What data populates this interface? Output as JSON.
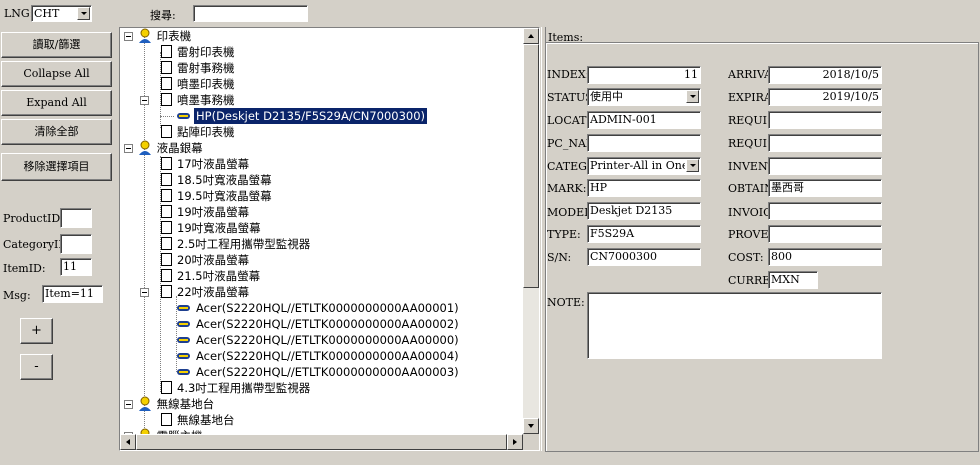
{
  "top": {
    "lng_label": "LNG:",
    "lng_value": "CHT",
    "search_label": "搜尋:",
    "search_value": ""
  },
  "left_buttons": {
    "read_filter": "讀取/篩選",
    "collapse_all": "Collapse All",
    "expand_all": "Expand All",
    "clear_all": "清除全部",
    "remove_selected": "移除選擇項目"
  },
  "left_fields": {
    "product_id_label": "ProductID:",
    "product_id": "",
    "category_id_label": "CategoryID:",
    "category_id": "",
    "item_id_label": "ItemID:",
    "item_id": "11",
    "msg_label": "Msg:",
    "msg": "Item=11",
    "plus": "+",
    "minus": "-"
  },
  "tree": {
    "cat1": "印表機",
    "cat1_items": [
      "雷射印表機",
      "雷射事務機",
      "噴墨印表機",
      "噴墨事務機"
    ],
    "cat1_selected_leaf": "HP(Deskjet D2135/F5S29A/CN7000300)",
    "cat1_last": "點陣印表機",
    "cat2": "液晶銀幕",
    "cat2_items": [
      "17吋液晶螢幕",
      "18.5吋寬液晶螢幕",
      "19.5吋寬液晶螢幕",
      "19吋液晶螢幕",
      "19吋寬液晶螢幕",
      "2.5吋工程用攜帶型監視器",
      "20吋液晶螢幕",
      "21.5吋液晶螢幕",
      "22吋液晶螢幕"
    ],
    "cat2_leaves": [
      "Acer(S2220HQL//ETLTK0000000000AA00001)",
      "Acer(S2220HQL//ETLTK0000000000AA00002)",
      "Acer(S2220HQL//ETLTK0000000000AA00000)",
      "Acer(S2220HQL//ETLTK0000000000AA00004)",
      "Acer(S2220HQL//ETLTK0000000000AA00003)"
    ],
    "cat2_last": "4.3吋工程用攜帶型監視器",
    "cat3": "無線基地台",
    "cat3_items": [
      "無線基地台"
    ],
    "cat4": "電腦主機"
  },
  "items": {
    "group_label": "Items:",
    "index_label": "INDEX:",
    "index": "11",
    "status_label": "STATUS",
    "status": "使用中",
    "location_label": "LOCATI",
    "location": "ADMIN-001",
    "pc_name_label": "PC_NAM",
    "pc_name": "",
    "category_label": "CATEGO",
    "category": "Printer-All in One In",
    "mark_label": "MARK:",
    "mark": "HP",
    "model_label": "MODEL",
    "model": "Deskjet D2135",
    "type_label": "TYPE:",
    "type": "F5S29A",
    "sn_label": "S/N:",
    "sn": "CN7000300",
    "arrival_label": "ARRIVA",
    "arrival": "2018/10/5",
    "expira_label": "EXPIRA",
    "expira": "2019/10/5",
    "requis1_label": "REQUIS",
    "requis1": "",
    "requis2_label": "REQUIS",
    "requis2": "",
    "invent_label": "INVENT",
    "invent": "",
    "obtain_label": "OBTAIN",
    "obtain": "墨西哥",
    "invoic_label": "INVOIC",
    "invoic": "",
    "provei_label": "PROVEI",
    "provei": "",
    "cost_label": "COST:",
    "cost": "800",
    "curre_label": "CURRE",
    "curre": "MXN",
    "note_label": "NOTE:",
    "note": ""
  }
}
